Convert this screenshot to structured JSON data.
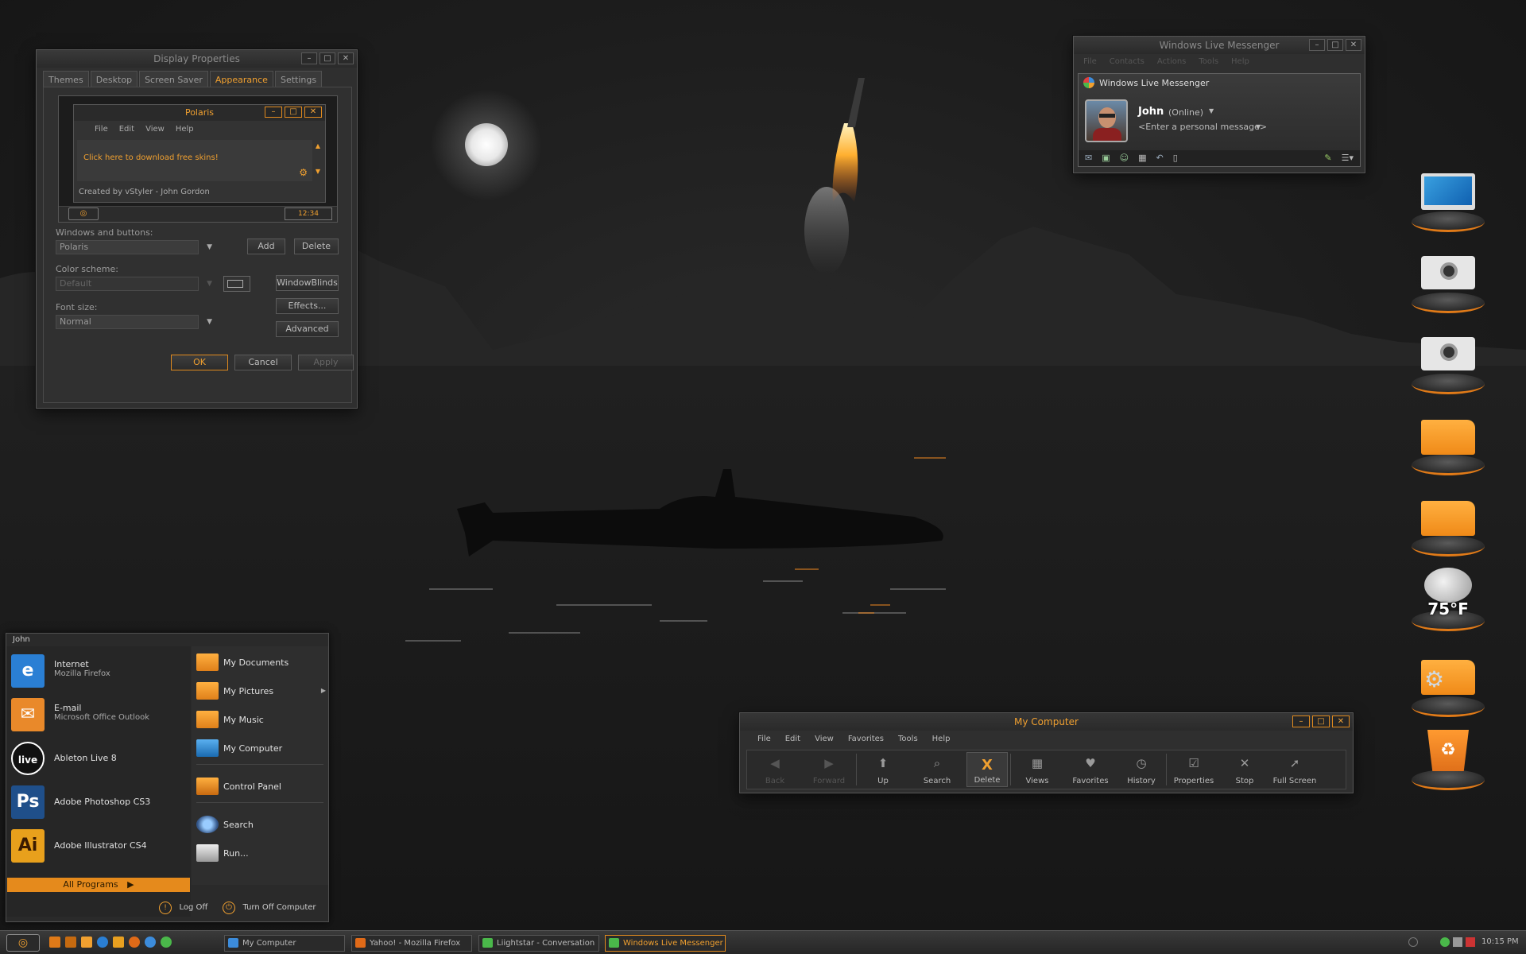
{
  "display_properties": {
    "title": "Display Properties",
    "tabs": [
      "Themes",
      "Desktop",
      "Screen Saver",
      "Appearance",
      "Settings"
    ],
    "active_tab": "Appearance",
    "preview": {
      "title": "Polaris",
      "menu": [
        "File",
        "Edit",
        "View",
        "Help"
      ],
      "link_text": "Click here to download free skins!",
      "credit": "Created by vStyler - John Gordon",
      "clock": "12:34"
    },
    "windows_and_buttons_label": "Windows and buttons:",
    "windows_and_buttons_value": "Polaris",
    "add_label": "Add",
    "delete_label": "Delete",
    "color_scheme_label": "Color scheme:",
    "color_scheme_value": "Default",
    "windowblinds_label": "WindowBlinds",
    "font_size_label": "Font size:",
    "font_size_value": "Normal",
    "effects_label": "Effects...",
    "advanced_label": "Advanced",
    "ok_label": "OK",
    "cancel_label": "Cancel",
    "apply_label": "Apply"
  },
  "messenger": {
    "title": "Windows Live Messenger",
    "menu": [
      "File",
      "Contacts",
      "Actions",
      "Tools",
      "Help"
    ],
    "header": "Windows Live Messenger",
    "user": "John",
    "status": "(Online)",
    "personal_message": "<Enter a personal message>"
  },
  "my_computer": {
    "title": "My Computer",
    "menu": [
      "File",
      "Edit",
      "View",
      "Favorites",
      "Tools",
      "Help"
    ],
    "toolbar": [
      {
        "label": "Back",
        "glyph": "◀",
        "enabled": false
      },
      {
        "label": "Forward",
        "glyph": "▶",
        "enabled": false
      },
      {
        "label": "Up",
        "glyph": "⬆",
        "enabled": true
      },
      {
        "label": "Search",
        "glyph": "⌕",
        "enabled": true
      },
      {
        "label": "Delete",
        "glyph": "X",
        "enabled": true
      },
      {
        "label": "Views",
        "glyph": "▦",
        "enabled": true
      },
      {
        "label": "Favorites",
        "glyph": "♥",
        "enabled": true
      },
      {
        "label": "History",
        "glyph": "◷",
        "enabled": true
      },
      {
        "label": "Properties",
        "glyph": "☑",
        "enabled": true
      },
      {
        "label": "Stop",
        "glyph": "✕",
        "enabled": true
      },
      {
        "label": "Full Screen",
        "glyph": "➚",
        "enabled": true
      }
    ]
  },
  "start_menu": {
    "user": "John",
    "pinned": [
      {
        "title": "Internet",
        "subtitle": "Mozilla Firefox",
        "icon": "ie-icon",
        "badge": "e",
        "color": "#2a7fd4"
      },
      {
        "title": "E-mail",
        "subtitle": "Microsoft Office Outlook",
        "icon": "mail-icon",
        "badge": "✉",
        "color": "#e9892a"
      },
      {
        "title": "Ableton Live 8",
        "subtitle": "",
        "icon": "ableton-icon",
        "badge": "live",
        "color": "#111111"
      },
      {
        "title": "Adobe Photoshop CS3",
        "subtitle": "",
        "icon": "photoshop-icon",
        "badge": "Ps",
        "color": "#1f4f8a"
      },
      {
        "title": "Adobe Illustrator CS4",
        "subtitle": "",
        "icon": "illustrator-icon",
        "badge": "Ai",
        "color": "#e8a01c"
      }
    ],
    "all_programs": "All Programs",
    "places": [
      {
        "label": "My Documents",
        "icon": "folder-icon",
        "arrow": false
      },
      {
        "label": "My Pictures",
        "icon": "folder-icon",
        "arrow": true
      },
      {
        "label": "My Music",
        "icon": "folder-icon",
        "arrow": false
      },
      {
        "label": "My Computer",
        "icon": "computer-icon",
        "arrow": false
      },
      {
        "label": "Control Panel",
        "icon": "control-panel-icon",
        "arrow": false
      },
      {
        "label": "Search",
        "icon": "search-icon",
        "arrow": false
      },
      {
        "label": "Run...",
        "icon": "run-icon",
        "arrow": false
      }
    ],
    "log_off": "Log Off",
    "turn_off": "Turn Off Computer"
  },
  "taskbar": {
    "tasks": [
      {
        "label": "My Computer",
        "active": false
      },
      {
        "label": "Yahoo! - Mozilla Firefox",
        "active": false
      },
      {
        "label": "Liightstar - Conversation",
        "active": false
      },
      {
        "label": "Windows Live Messenger",
        "active": true
      }
    ],
    "clock": "10:15 PM"
  },
  "desktop": {
    "weather_temp": "75°F",
    "icons": [
      "monitor-icon",
      "drive-icon",
      "drive-icon",
      "folder-icon",
      "folder-icon",
      "weather-icon",
      "settings-folder-icon",
      "recycle-bin-icon"
    ]
  },
  "colors": {
    "accent": "#f0a030",
    "window_bg": "#2f2f2f",
    "desktop_bg": "#1e1e1e"
  }
}
